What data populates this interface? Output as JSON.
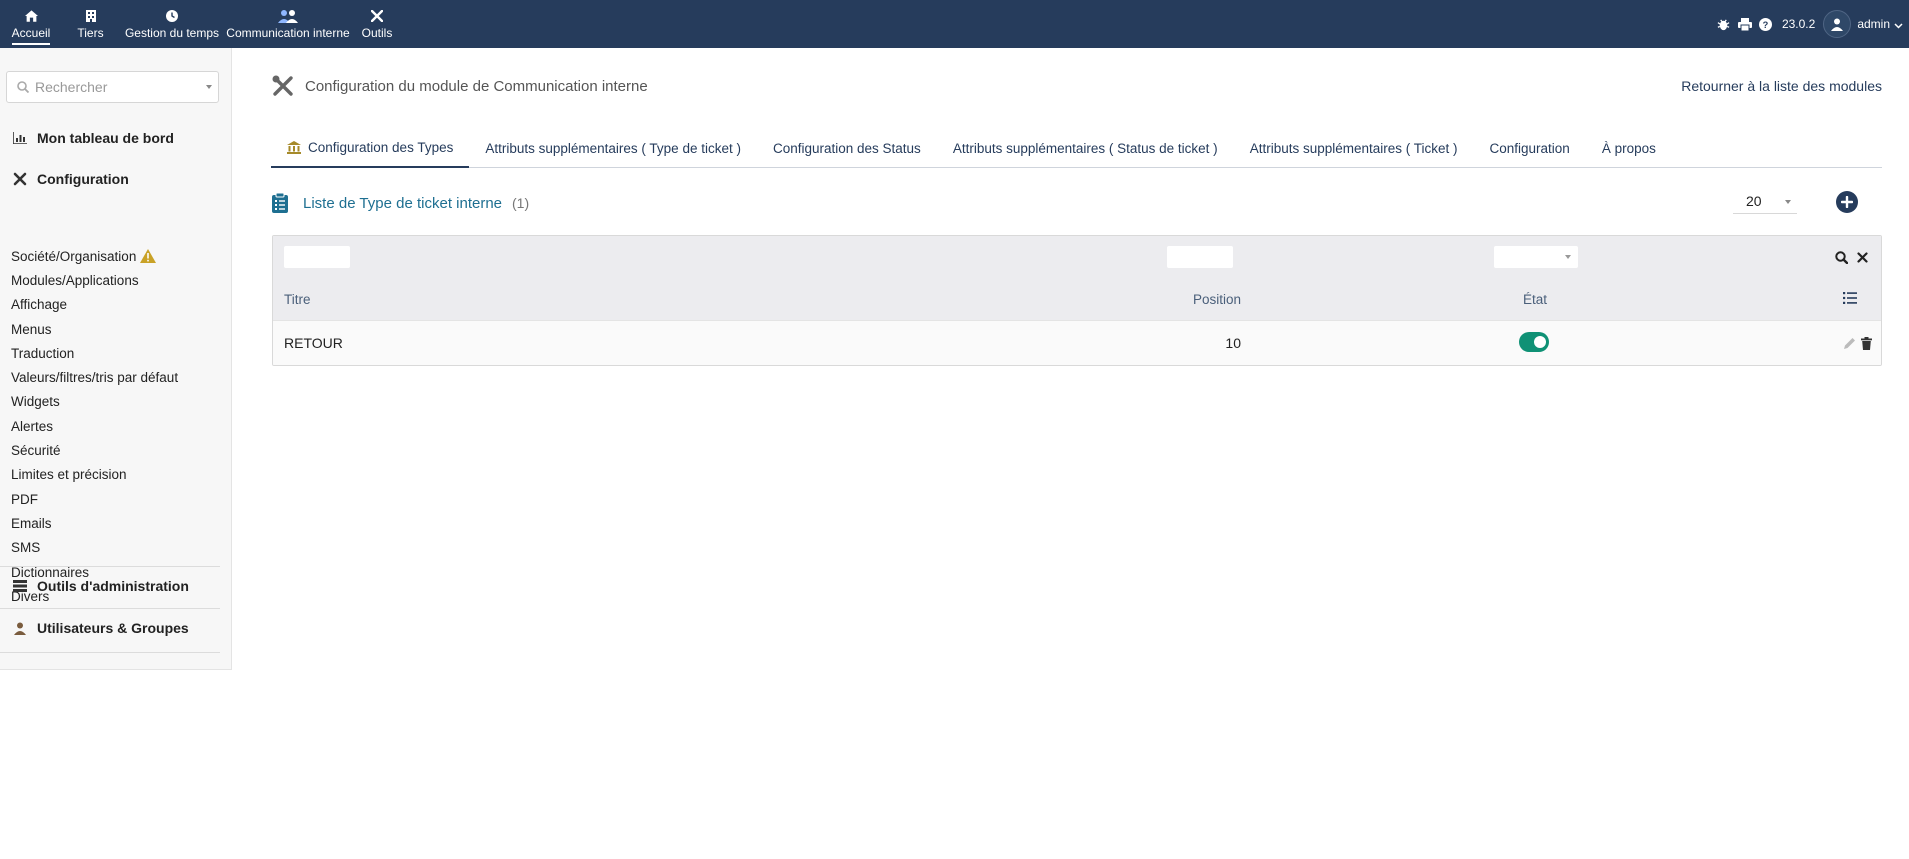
{
  "topnav": {
    "items": [
      {
        "label": "Accueil",
        "icon": "home-icon"
      },
      {
        "label": "Tiers",
        "icon": "building-icon"
      },
      {
        "label": "Gestion du temps",
        "icon": "clock-icon"
      },
      {
        "label": "Communication interne",
        "icon": "users-icon"
      },
      {
        "label": "Outils",
        "icon": "tools-icon"
      }
    ],
    "version": "23.0.2",
    "user": "admin"
  },
  "sidebar": {
    "search_placeholder": "Rechercher",
    "dashboard_label": "Mon tableau de bord",
    "config_label": "Configuration",
    "config_items": [
      "Société/Organisation",
      "Modules/Applications",
      "Affichage",
      "Menus",
      "Traduction",
      "Valeurs/filtres/tris par défaut",
      "Widgets",
      "Alertes",
      "Sécurité",
      "Limites et précision",
      "PDF",
      "Emails",
      "SMS",
      "Dictionnaires",
      "Divers"
    ],
    "admin_tools_label": "Outils d'administration",
    "users_groups_label": "Utilisateurs & Groupes"
  },
  "main": {
    "title": "Configuration du module de Communication interne",
    "back_link": "Retourner à la liste des modules",
    "tabs": [
      "Configuration des Types",
      "Attributs supplémentaires ( Type de ticket )",
      "Configuration des Status",
      "Attributs supplémentaires ( Status de ticket )",
      "Attributs supplémentaires ( Ticket )",
      "Configuration",
      "À propos"
    ],
    "list_title": "Liste de Type de ticket interne",
    "list_count": "(1)",
    "limit": "20"
  },
  "table": {
    "headers": {
      "title": "Titre",
      "position": "Position",
      "state": "État"
    },
    "rows": [
      {
        "title": "RETOUR",
        "position": "10",
        "active": true
      }
    ]
  },
  "colors": {
    "topbar": "#263c5c",
    "accent_link": "#1e6f91",
    "toggle_on": "#0f9175",
    "warning": "#c9a227"
  }
}
